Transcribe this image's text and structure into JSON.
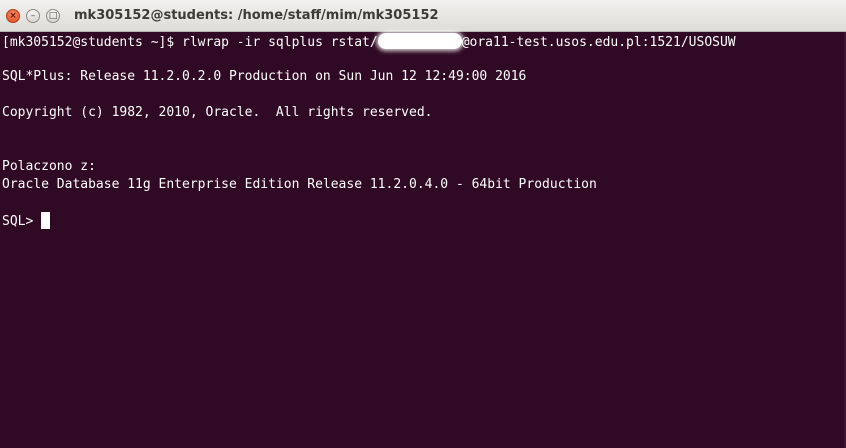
{
  "window": {
    "title": "mk305152@students: /home/staff/mim/mk305152",
    "close_glyph": "×",
    "minimize_glyph": "–",
    "maximize_glyph": "□",
    "colors": {
      "terminal_bg": "#300a24",
      "terminal_fg": "#ffffff",
      "titlebar_bg": "#dedcd8",
      "close_btn": "#df4b1d"
    }
  },
  "terminal": {
    "command_prefix": "[mk305152@students ~]$ rlwrap -ir sqlplus rstat/",
    "command_suffix": "@ora11-test.usos.edu.pl:1521/USOSUW",
    "release_line": "SQL*Plus: Release 11.2.0.2.0 Production on Sun Jun 12 12:49:00 2016",
    "copyright_line": "Copyright (c) 1982, 2010, Oracle.  All rights reserved.",
    "connected_line": "Polaczono z:",
    "database_line": "Oracle Database 11g Enterprise Edition Release 11.2.0.4.0 - 64bit Production",
    "prompt": "SQL> "
  }
}
